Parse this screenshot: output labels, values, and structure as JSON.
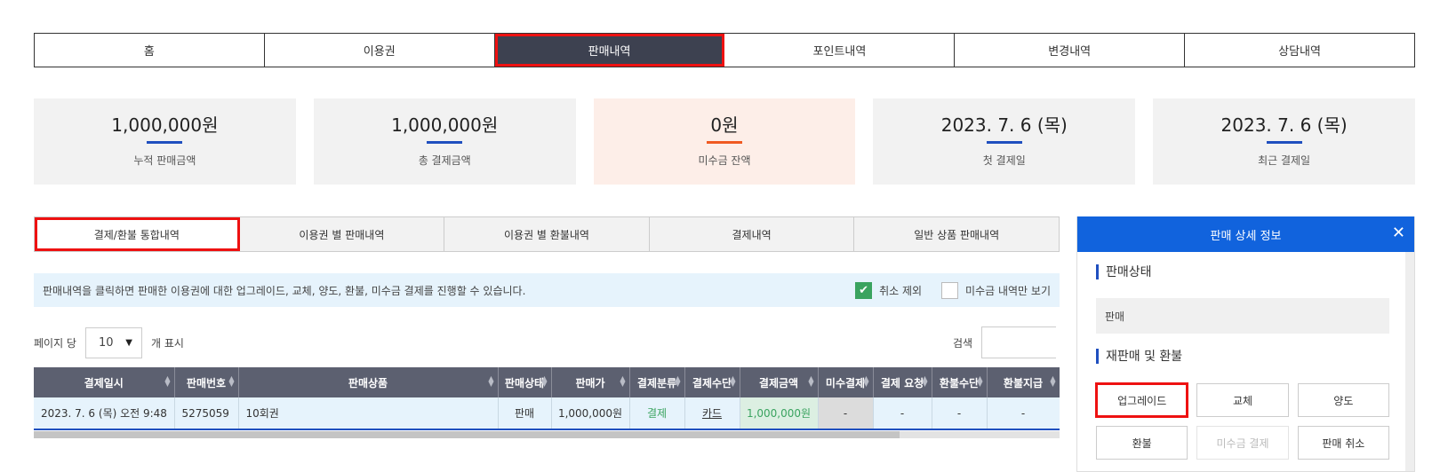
{
  "nav": {
    "tabs": [
      "홈",
      "이용권",
      "판매내역",
      "포인트내역",
      "변경내역",
      "상담내역"
    ],
    "active_index": 2
  },
  "summary": [
    {
      "value": "1,000,000원",
      "label": "누적 판매금액"
    },
    {
      "value": "1,000,000원",
      "label": "총 결제금액"
    },
    {
      "value": "0원",
      "label": "미수금 잔액"
    },
    {
      "value": "2023. 7. 6 (목)",
      "label": "첫 결제일"
    },
    {
      "value": "2023. 7. 6 (목)",
      "label": "최근 결제일"
    }
  ],
  "subtabs": {
    "items": [
      "결제/환불 통합내역",
      "이용권 별 판매내역",
      "이용권 별 환불내역",
      "결제내역",
      "일반 상품 판매내역"
    ],
    "active_index": 0
  },
  "info": {
    "message": "판매내역을 클릭하면 판매한 이용권에 대한 업그레이드, 교체, 양도, 환불, 미수금 결제를 진행할 수 있습니다.",
    "exclude_cancel_label": "취소 제외",
    "exclude_cancel_checked": true,
    "unpaid_only_label": "미수금 내역만 보기",
    "unpaid_only_checked": false
  },
  "paging": {
    "prefix": "페이지 당",
    "size": "10",
    "suffix": "개 표시",
    "search_label": "검색"
  },
  "table": {
    "headers": [
      "결제일시",
      "판매번호",
      "판매상품",
      "판매상태",
      "판매가",
      "결제분류",
      "결제수단",
      "결제금액",
      "미수결제",
      "결제 요청",
      "환불수단",
      "환불지급"
    ],
    "rows": [
      [
        "2023. 7. 6 (목) 오전 9:48",
        "5275059",
        "10회권",
        "판매",
        "1,000,000원",
        "결제",
        "카드",
        "1,000,000원",
        "-",
        "-",
        "-",
        "-"
      ]
    ]
  },
  "panel": {
    "title": "판매 상세 정보",
    "status_section": "판매상태",
    "status_value": "판매",
    "actions_section": "재판매 및 환불",
    "buttons": [
      "업그레이드",
      "교체",
      "양도",
      "환불",
      "미수금 결제",
      "판매 취소"
    ]
  },
  "colors": {
    "accent_blue": "#1163dd",
    "highlight_red": "#e11111",
    "success_green": "#3aa35f",
    "alert_orange": "#f05a22",
    "nav_dark": "#3d4150"
  }
}
